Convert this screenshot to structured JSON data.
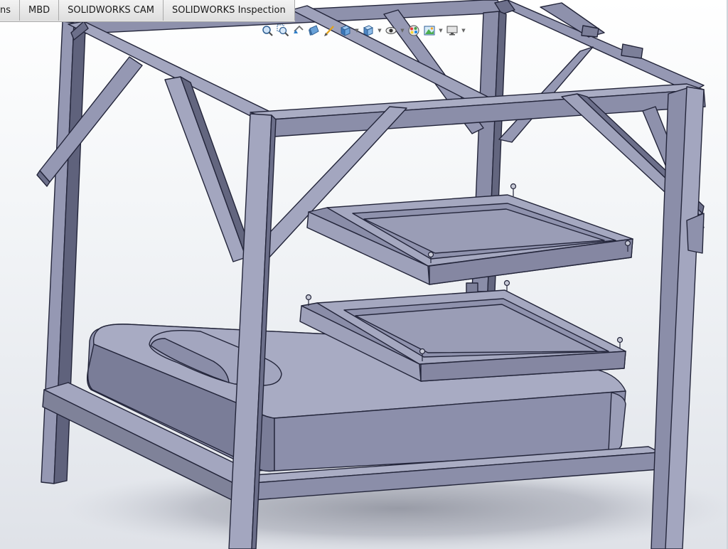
{
  "tabs": [
    {
      "id": "tab-ns",
      "label": "ns"
    },
    {
      "id": "tab-mbd",
      "label": "MBD"
    },
    {
      "id": "tab-cam",
      "label": "SOLIDWORKS CAM"
    },
    {
      "id": "tab-inspection",
      "label": "SOLIDWORKS Inspection"
    }
  ],
  "toolbar": [
    {
      "name": "zoom-to-fit-icon",
      "dropdown": false
    },
    {
      "name": "zoom-to-area-icon",
      "dropdown": false
    },
    {
      "name": "previous-view-icon",
      "dropdown": false
    },
    {
      "name": "section-view-icon",
      "dropdown": false
    },
    {
      "name": "dynamic-annotation-icon",
      "dropdown": false
    },
    {
      "name": "view-orientation-icon",
      "dropdown": true
    },
    {
      "name": "display-style-icon",
      "dropdown": true
    },
    {
      "name": "hide-show-items-icon",
      "dropdown": true
    },
    {
      "name": "edit-appearance-icon",
      "dropdown": false
    },
    {
      "name": "apply-scene-icon",
      "dropdown": true
    },
    {
      "name": "view-settings-icon",
      "dropdown": true
    }
  ],
  "colors": {
    "frame": "#9598b3",
    "frame_dark": "#5c5f7a",
    "frame_light": "#b7bad0",
    "edge": "#23253a",
    "background_top": "#ffffff",
    "background_bottom": "#dfe2e8",
    "tab_bar": "#e7e7e7"
  }
}
